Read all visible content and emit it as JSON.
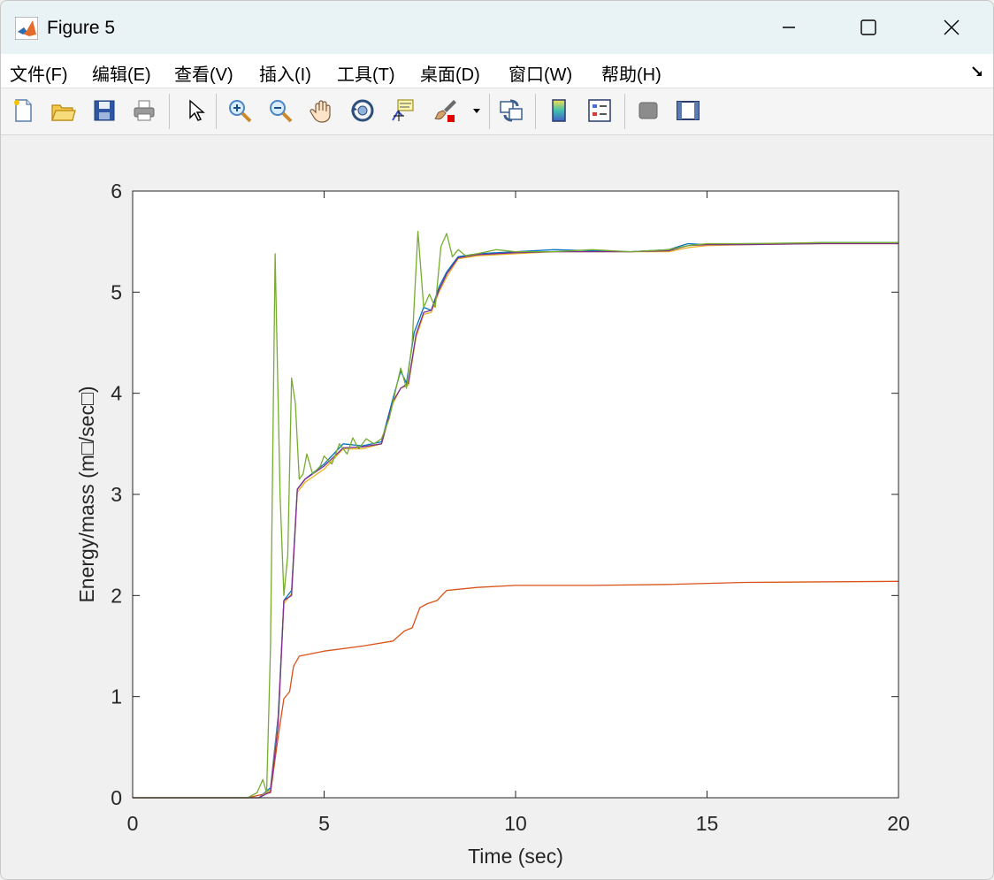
{
  "window": {
    "title": "Figure 5"
  },
  "menu": [
    {
      "label": "文件(F)"
    },
    {
      "label": "编辑(E)"
    },
    {
      "label": "查看(V)"
    },
    {
      "label": "插入(I)"
    },
    {
      "label": "工具(T)"
    },
    {
      "label": "桌面(D)"
    },
    {
      "label": "窗口(W)"
    },
    {
      "label": "帮助(H)"
    }
  ],
  "toolbar": {
    "icons": [
      "new-figure-icon",
      "open-file-icon",
      "save-icon",
      "print-icon",
      "select-pointer-icon",
      "zoom-in-icon",
      "zoom-out-icon",
      "pan-hand-icon",
      "rotate-3d-icon",
      "data-cursor-icon",
      "brush-icon",
      "brush-dropdown-icon",
      "link-plot-icon",
      "colorbar-icon",
      "legend-icon",
      "hide-plot-tools-icon",
      "show-plot-tools-icon"
    ]
  },
  "colors": {
    "blue": "#0072BD",
    "orange": "#D95319",
    "yellow": "#EDB120",
    "purple": "#7E2F8E",
    "green": "#77AC30"
  },
  "chart_data": {
    "type": "line",
    "xlabel": "Time (sec)",
    "ylabel": "Energy/mass (m□/sec□)",
    "xlim": [
      0,
      20
    ],
    "ylim": [
      0,
      6
    ],
    "xticks": [
      0,
      5,
      10,
      15,
      20
    ],
    "yticks": [
      0,
      1,
      2,
      3,
      4,
      5,
      6
    ],
    "grid": false,
    "series": [
      {
        "color": "#D95319",
        "points": [
          [
            0,
            0
          ],
          [
            3,
            0
          ],
          [
            3.6,
            0.05
          ],
          [
            3.8,
            0.6
          ],
          [
            3.95,
            0.98
          ],
          [
            4.1,
            1.05
          ],
          [
            4.2,
            1.3
          ],
          [
            4.35,
            1.4
          ],
          [
            5,
            1.45
          ],
          [
            6,
            1.5
          ],
          [
            6.8,
            1.55
          ],
          [
            7.1,
            1.65
          ],
          [
            7.3,
            1.68
          ],
          [
            7.5,
            1.88
          ],
          [
            7.7,
            1.92
          ],
          [
            7.95,
            1.95
          ],
          [
            8.2,
            2.05
          ],
          [
            9,
            2.08
          ],
          [
            10,
            2.1
          ],
          [
            12,
            2.1
          ],
          [
            14,
            2.11
          ],
          [
            16,
            2.13
          ],
          [
            20,
            2.14
          ]
        ]
      },
      {
        "color": "#0072BD",
        "points": [
          [
            0,
            0
          ],
          [
            3.3,
            0
          ],
          [
            3.6,
            0.1
          ],
          [
            3.8,
            0.8
          ],
          [
            3.95,
            1.95
          ],
          [
            4.15,
            2.05
          ],
          [
            4.3,
            3.05
          ],
          [
            4.5,
            3.15
          ],
          [
            5,
            3.3
          ],
          [
            5.5,
            3.5
          ],
          [
            6,
            3.48
          ],
          [
            6.5,
            3.52
          ],
          [
            6.8,
            3.95
          ],
          [
            7.0,
            4.22
          ],
          [
            7.15,
            4.1
          ],
          [
            7.35,
            4.6
          ],
          [
            7.6,
            4.85
          ],
          [
            7.8,
            4.82
          ],
          [
            8.0,
            5.05
          ],
          [
            8.2,
            5.2
          ],
          [
            8.5,
            5.35
          ],
          [
            9,
            5.38
          ],
          [
            10,
            5.4
          ],
          [
            11,
            5.42
          ],
          [
            13,
            5.4
          ],
          [
            14,
            5.42
          ],
          [
            14.5,
            5.48
          ],
          [
            15,
            5.47
          ],
          [
            16,
            5.48
          ],
          [
            17,
            5.48
          ],
          [
            18,
            5.49
          ],
          [
            20,
            5.49
          ]
        ]
      },
      {
        "color": "#EDB120",
        "points": [
          [
            0,
            0
          ],
          [
            3.3,
            0
          ],
          [
            3.6,
            0.08
          ],
          [
            3.8,
            0.75
          ],
          [
            3.95,
            1.92
          ],
          [
            4.15,
            2.02
          ],
          [
            4.3,
            3.02
          ],
          [
            4.5,
            3.12
          ],
          [
            5,
            3.25
          ],
          [
            5.5,
            3.45
          ],
          [
            6,
            3.45
          ],
          [
            6.5,
            3.5
          ],
          [
            6.8,
            3.9
          ],
          [
            7.0,
            4.05
          ],
          [
            7.2,
            4.08
          ],
          [
            7.4,
            4.55
          ],
          [
            7.6,
            4.78
          ],
          [
            7.8,
            4.8
          ],
          [
            8.0,
            5.0
          ],
          [
            8.2,
            5.15
          ],
          [
            8.5,
            5.33
          ],
          [
            9,
            5.36
          ],
          [
            10,
            5.38
          ],
          [
            11,
            5.4
          ],
          [
            13,
            5.4
          ],
          [
            14,
            5.4
          ],
          [
            14.5,
            5.44
          ],
          [
            15,
            5.46
          ],
          [
            16,
            5.47
          ],
          [
            18,
            5.48
          ],
          [
            20,
            5.48
          ]
        ]
      },
      {
        "color": "#7E2F8E",
        "points": [
          [
            0,
            0
          ],
          [
            3.3,
            0
          ],
          [
            3.6,
            0.06
          ],
          [
            3.8,
            0.72
          ],
          [
            3.95,
            1.95
          ],
          [
            4.15,
            2.0
          ],
          [
            4.3,
            3.05
          ],
          [
            4.5,
            3.15
          ],
          [
            5,
            3.28
          ],
          [
            5.5,
            3.46
          ],
          [
            6,
            3.47
          ],
          [
            6.5,
            3.5
          ],
          [
            6.8,
            3.92
          ],
          [
            7.0,
            4.05
          ],
          [
            7.2,
            4.1
          ],
          [
            7.4,
            4.58
          ],
          [
            7.6,
            4.8
          ],
          [
            7.8,
            4.82
          ],
          [
            8.0,
            5.02
          ],
          [
            8.2,
            5.18
          ],
          [
            8.5,
            5.34
          ],
          [
            9,
            5.37
          ],
          [
            10,
            5.39
          ],
          [
            11,
            5.4
          ],
          [
            13,
            5.4
          ],
          [
            14,
            5.41
          ],
          [
            14.5,
            5.46
          ],
          [
            15,
            5.47
          ],
          [
            16,
            5.47
          ],
          [
            18,
            5.48
          ],
          [
            20,
            5.48
          ]
        ]
      },
      {
        "color": "#77AC30",
        "points": [
          [
            0,
            0
          ],
          [
            3.0,
            0
          ],
          [
            3.25,
            0.05
          ],
          [
            3.4,
            0.18
          ],
          [
            3.5,
            0.05
          ],
          [
            3.6,
            1.5
          ],
          [
            3.72,
            5.38
          ],
          [
            3.85,
            3.0
          ],
          [
            3.95,
            2.0
          ],
          [
            4.05,
            2.4
          ],
          [
            4.15,
            4.15
          ],
          [
            4.25,
            3.9
          ],
          [
            4.35,
            3.15
          ],
          [
            4.45,
            3.2
          ],
          [
            4.55,
            3.4
          ],
          [
            4.7,
            3.2
          ],
          [
            4.9,
            3.28
          ],
          [
            5.0,
            3.38
          ],
          [
            5.2,
            3.3
          ],
          [
            5.4,
            3.5
          ],
          [
            5.6,
            3.4
          ],
          [
            5.75,
            3.56
          ],
          [
            5.9,
            3.45
          ],
          [
            6.1,
            3.55
          ],
          [
            6.3,
            3.5
          ],
          [
            6.5,
            3.55
          ],
          [
            6.7,
            3.75
          ],
          [
            6.85,
            4.0
          ],
          [
            7.0,
            4.25
          ],
          [
            7.15,
            4.05
          ],
          [
            7.3,
            4.5
          ],
          [
            7.45,
            5.6
          ],
          [
            7.6,
            4.85
          ],
          [
            7.75,
            4.98
          ],
          [
            7.9,
            4.85
          ],
          [
            8.05,
            5.45
          ],
          [
            8.2,
            5.58
          ],
          [
            8.35,
            5.35
          ],
          [
            8.5,
            5.42
          ],
          [
            8.7,
            5.36
          ],
          [
            9,
            5.38
          ],
          [
            9.5,
            5.42
          ],
          [
            10,
            5.4
          ],
          [
            11,
            5.4
          ],
          [
            12,
            5.42
          ],
          [
            13,
            5.4
          ],
          [
            14,
            5.42
          ],
          [
            14.5,
            5.46
          ],
          [
            15,
            5.48
          ],
          [
            16,
            5.48
          ],
          [
            18,
            5.49
          ],
          [
            20,
            5.49
          ]
        ]
      }
    ]
  }
}
